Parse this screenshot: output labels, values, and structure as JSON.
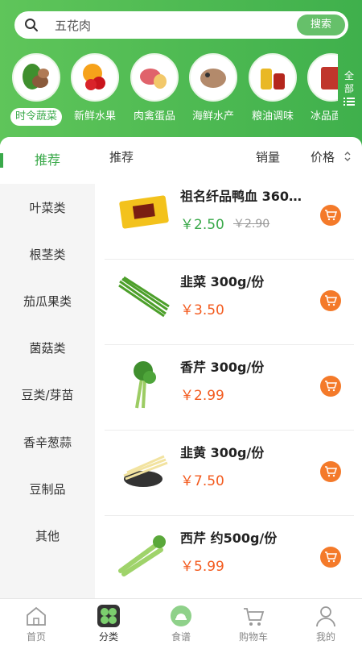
{
  "search": {
    "value": "五花肉",
    "button_label": "搜索"
  },
  "categories": [
    {
      "label": "时令蔬菜",
      "active": true
    },
    {
      "label": "新鲜水果",
      "active": false
    },
    {
      "label": "肉禽蛋品",
      "active": false
    },
    {
      "label": "海鲜水产",
      "active": false
    },
    {
      "label": "粮油调味",
      "active": false
    },
    {
      "label": "冰品面点",
      "active": false
    }
  ],
  "all_button": {
    "line1": "全",
    "line2": "部"
  },
  "sidebar": {
    "items": [
      {
        "label": "推荐"
      },
      {
        "label": "叶菜类"
      },
      {
        "label": "根茎类"
      },
      {
        "label": "茄瓜果类"
      },
      {
        "label": "菌菇类"
      },
      {
        "label": "豆类/芽苗"
      },
      {
        "label": "香辛葱蒜"
      },
      {
        "label": "豆制品"
      },
      {
        "label": "其他"
      }
    ]
  },
  "sort": {
    "recommend": "推荐",
    "sales": "销量",
    "price": "价格"
  },
  "products": [
    {
      "name": "祖名纤品鸭血 360…",
      "price": "￥2.50",
      "old_price": "￥2.90"
    },
    {
      "name": "韭菜 300g/份",
      "price": "￥3.50"
    },
    {
      "name": "香芹 300g/份",
      "price": "￥2.99"
    },
    {
      "name": "韭黄 300g/份",
      "price": "￥7.50"
    },
    {
      "name": "西芹 约500g/份",
      "price": "￥5.99"
    }
  ],
  "tabbar": {
    "items": [
      {
        "label": "首页",
        "icon": "home-icon"
      },
      {
        "label": "分类",
        "icon": "category-icon"
      },
      {
        "label": "食谱",
        "icon": "recipe-icon"
      },
      {
        "label": "购物车",
        "icon": "cart-icon"
      },
      {
        "label": "我的",
        "icon": "profile-icon"
      }
    ]
  },
  "colors": {
    "brand_green": "#3aa94a",
    "price_orange": "#f35b1f",
    "cart_orange": "#f47a2a"
  }
}
